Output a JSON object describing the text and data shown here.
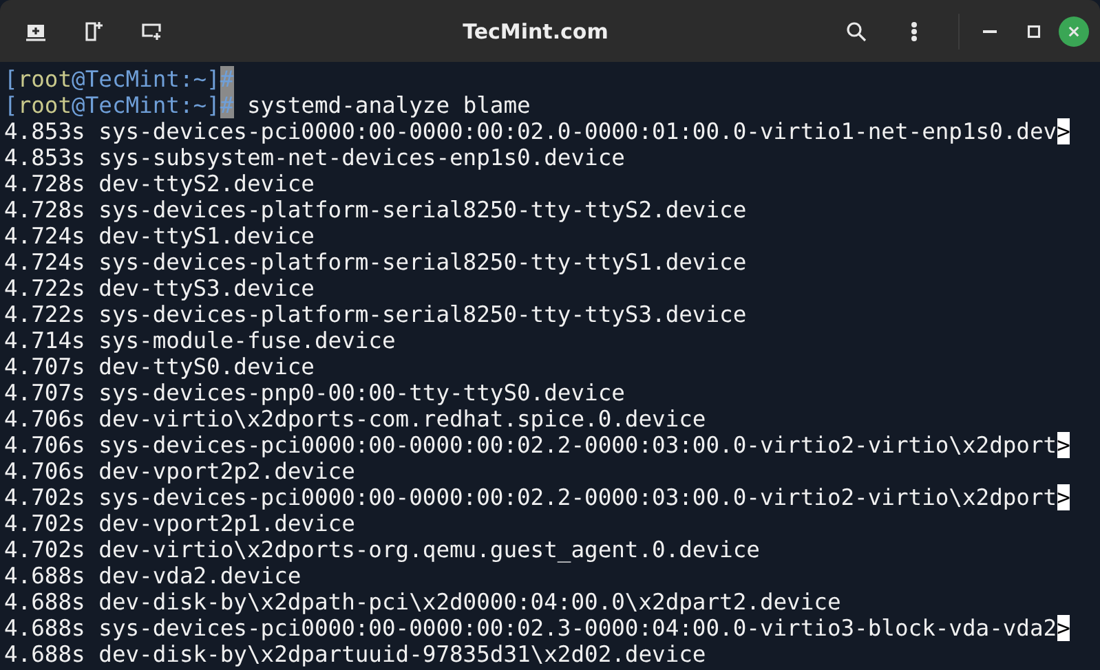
{
  "window": {
    "title": "TecMint.com"
  },
  "terminal": {
    "truncation_marker": ">",
    "prompts": [
      {
        "segments": [
          {
            "kind": "punct",
            "text": "["
          },
          {
            "kind": "user",
            "text": "root"
          },
          {
            "kind": "punct",
            "text": "@TecMint:~]"
          },
          {
            "kind": "cursor",
            "text": "#"
          }
        ]
      },
      {
        "segments": [
          {
            "kind": "punct",
            "text": "["
          },
          {
            "kind": "user",
            "text": "root"
          },
          {
            "kind": "punct",
            "text": "@TecMint:~]"
          },
          {
            "kind": "cursor",
            "text": "#"
          }
        ],
        "command": "systemd-analyze blame"
      }
    ],
    "rows": [
      {
        "time": "4.853s",
        "unit": "sys-devices-pci0000:00-0000:00:02.0-0000:01:00.0-virtio1-net-enp1s0.dev",
        "truncated": true
      },
      {
        "time": "4.853s",
        "unit": "sys-subsystem-net-devices-enp1s0.device",
        "truncated": false
      },
      {
        "time": "4.728s",
        "unit": "dev-ttyS2.device",
        "truncated": false
      },
      {
        "time": "4.728s",
        "unit": "sys-devices-platform-serial8250-tty-ttyS2.device",
        "truncated": false
      },
      {
        "time": "4.724s",
        "unit": "dev-ttyS1.device",
        "truncated": false
      },
      {
        "time": "4.724s",
        "unit": "sys-devices-platform-serial8250-tty-ttyS1.device",
        "truncated": false
      },
      {
        "time": "4.722s",
        "unit": "dev-ttyS3.device",
        "truncated": false
      },
      {
        "time": "4.722s",
        "unit": "sys-devices-platform-serial8250-tty-ttyS3.device",
        "truncated": false
      },
      {
        "time": "4.714s",
        "unit": "sys-module-fuse.device",
        "truncated": false
      },
      {
        "time": "4.707s",
        "unit": "dev-ttyS0.device",
        "truncated": false
      },
      {
        "time": "4.707s",
        "unit": "sys-devices-pnp0-00:00-tty-ttyS0.device",
        "truncated": false
      },
      {
        "time": "4.706s",
        "unit": "dev-virtio\\x2dports-com.redhat.spice.0.device",
        "truncated": false
      },
      {
        "time": "4.706s",
        "unit": "sys-devices-pci0000:00-0000:00:02.2-0000:03:00.0-virtio2-virtio\\x2dport",
        "truncated": true
      },
      {
        "time": "4.706s",
        "unit": "dev-vport2p2.device",
        "truncated": false
      },
      {
        "time": "4.702s",
        "unit": "sys-devices-pci0000:00-0000:00:02.2-0000:03:00.0-virtio2-virtio\\x2dport",
        "truncated": true
      },
      {
        "time": "4.702s",
        "unit": "dev-vport2p1.device",
        "truncated": false
      },
      {
        "time": "4.702s",
        "unit": "dev-virtio\\x2dports-org.qemu.guest_agent.0.device",
        "truncated": false
      },
      {
        "time": "4.688s",
        "unit": "dev-vda2.device",
        "truncated": false
      },
      {
        "time": "4.688s",
        "unit": "dev-disk-by\\x2dpath-pci\\x2d0000:04:00.0\\x2dpart2.device",
        "truncated": false
      },
      {
        "time": "4.688s",
        "unit": "sys-devices-pci0000:00-0000:00:02.3-0000:04:00.0-virtio3-block-vda-vda2",
        "truncated": true
      },
      {
        "time": "4.688s",
        "unit": "dev-disk-by\\x2dpartuuid-97835d31\\x2d02.device",
        "truncated": false
      }
    ]
  }
}
